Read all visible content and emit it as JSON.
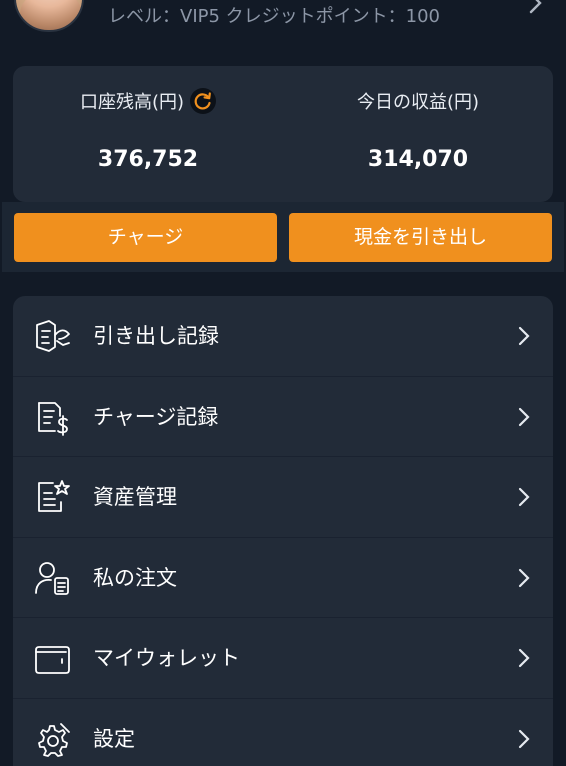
{
  "header": {
    "level_text": "レベル：VIP5  クレジットポイント：100"
  },
  "balance": {
    "account_label": "口座残高(円)",
    "account_value": "376,752",
    "today_label": "今日の収益(円)",
    "today_value": "314,070"
  },
  "actions": {
    "charge_label": "チャージ",
    "withdraw_label": "現金を引き出し"
  },
  "menu": {
    "items": [
      {
        "label": "引き出し記録",
        "icon": "withdrawal-record-icon"
      },
      {
        "label": "チャージ記録",
        "icon": "charge-record-icon"
      },
      {
        "label": "資産管理",
        "icon": "asset-management-icon"
      },
      {
        "label": "私の注文",
        "icon": "my-orders-icon"
      },
      {
        "label": "マイウォレット",
        "icon": "wallet-icon"
      },
      {
        "label": "設定",
        "icon": "settings-icon"
      }
    ]
  },
  "colors": {
    "background": "#121a26",
    "card": "#222b38",
    "accent": "#f0901e",
    "muted_text": "#8c96a6"
  }
}
